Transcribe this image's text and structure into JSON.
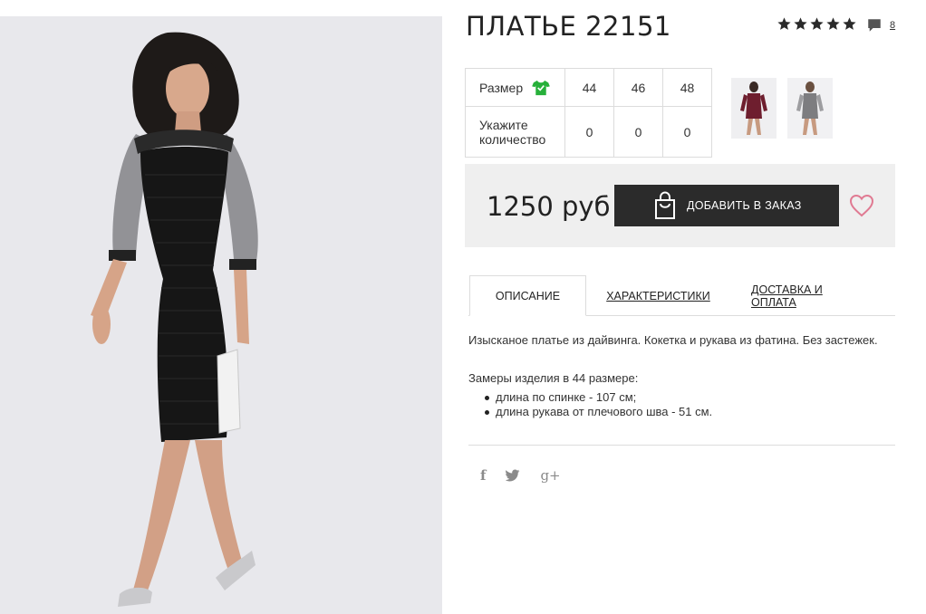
{
  "product": {
    "title": "ПЛАТЬЕ 22151",
    "rating_stars": 5,
    "comments_count": "8",
    "price": "1250 руб"
  },
  "size_table": {
    "size_label": "Размер",
    "quantity_label": "Укажите количество",
    "sizes": [
      "44",
      "46",
      "48"
    ],
    "quantities": [
      "0",
      "0",
      "0"
    ]
  },
  "buy": {
    "add_label": "ДОБАВИТЬ В ЗАКАЗ"
  },
  "tabs": [
    {
      "label": "ОПИСАНИЕ",
      "active": true
    },
    {
      "label": "ХАРАКТЕРИСТИКИ",
      "active": false
    },
    {
      "label": "ДОСТАВКА И ОПЛАТА",
      "active": false
    }
  ],
  "description": {
    "text": "Изысканое платье из дайвинга. Кокетка и рукава из фатина. Без застежек.",
    "measure_title": "Замеры изделия в 44 размере:",
    "measures": [
      "длина по спинке - 107 см;",
      "длина рукава от плечового шва - 51 см."
    ]
  },
  "social": {
    "facebook": "f",
    "googleplus": "g+"
  },
  "colors": {
    "accent_green": "#27b03a",
    "heart_pink": "#e07a92",
    "button_dark": "#2b2b2b",
    "price_box_bg": "#efefef"
  },
  "icons": {
    "rating": "star-icon",
    "comments": "speech-bubble-icon",
    "size_chart": "tshirt-icon",
    "add_to_order": "shopping-bag-icon",
    "wishlist": "heart-icon",
    "share_facebook": "facebook-icon",
    "share_twitter": "twitter-icon",
    "share_googleplus": "googleplus-icon"
  }
}
